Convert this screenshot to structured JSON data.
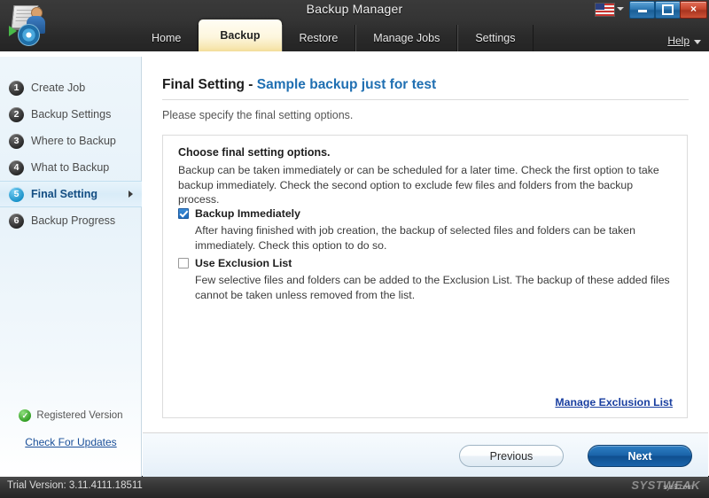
{
  "window": {
    "title": "Backup Manager",
    "logo_icon": "backup-folder-person-disc-icon",
    "language_flag": "us-flag-icon",
    "minimize_label": "Minimize",
    "maximize_label": "Maximize",
    "close_label": "×"
  },
  "tabs": [
    {
      "label": "Home",
      "active": false
    },
    {
      "label": "Backup",
      "active": true
    },
    {
      "label": "Restore",
      "active": false
    },
    {
      "label": "Manage Jobs",
      "active": false
    },
    {
      "label": "Settings",
      "active": false
    }
  ],
  "help": {
    "label": "Help",
    "caret_icon": "chevron-down-icon"
  },
  "sidebar": {
    "items": [
      {
        "number": "1",
        "label": "Create Job",
        "active": false
      },
      {
        "number": "2",
        "label": "Backup Settings",
        "active": false
      },
      {
        "number": "3",
        "label": "Where to Backup",
        "active": false
      },
      {
        "number": "4",
        "label": "What to Backup",
        "active": false
      },
      {
        "number": "5",
        "label": "Final Setting",
        "active": true
      },
      {
        "number": "6",
        "label": "Backup Progress",
        "active": false
      }
    ],
    "registered": {
      "icon": "green-check-icon",
      "check_glyph": "✓",
      "label": "Registered Version"
    },
    "check_updates_label": "Check For Updates"
  },
  "main": {
    "title_prefix": "Final Setting - ",
    "title_job": "Sample backup just for test",
    "subtitle": "Please specify the final setting options.",
    "panel": {
      "heading": "Choose final setting options.",
      "description": "Backup can be taken immediately or can be scheduled for a later time. Check the first option to take backup immediately. Check the second option to exclude few files and folders from the backup process.",
      "options": [
        {
          "label": "Backup Immediately",
          "checked": true,
          "description": "After having finished with job creation, the backup of selected files and folders can be taken immediately. Check this option to do so."
        },
        {
          "label": "Use Exclusion List",
          "checked": false,
          "description": "Few selective files and folders can be added to the Exclusion List. The backup of these added files cannot be taken unless removed from the list."
        }
      ],
      "manage_link": "Manage Exclusion List"
    }
  },
  "footer": {
    "previous_label": "Previous",
    "next_label": "Next"
  },
  "statusbar": {
    "text": "Trial Version: 3.11.4111.18511",
    "watermark": "SYSTWEAK",
    "watermark_sub": "sys9.com"
  },
  "colors": {
    "accent_blue": "#1f6fb2",
    "active_tab": "#f7e7b2",
    "link": "#1a3fa0",
    "checkbox_checked": "#1f6cbd",
    "registered_green": "#2f9b21"
  }
}
